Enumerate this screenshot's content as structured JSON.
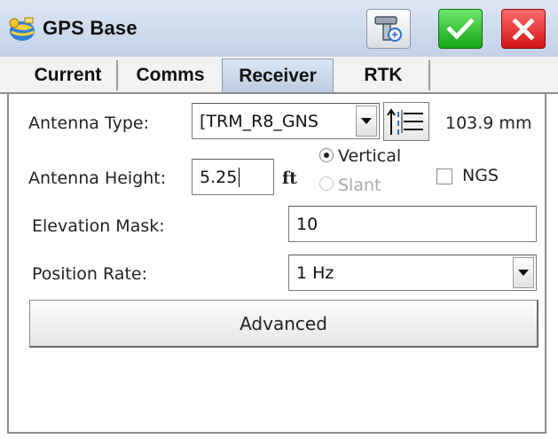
{
  "window": {
    "title": "GPS Base"
  },
  "tabs": [
    {
      "label": "Current"
    },
    {
      "label": "Comms"
    },
    {
      "label": "Receiver"
    },
    {
      "label": "RTK"
    }
  ],
  "form": {
    "antenna_type_label": "Antenna Type:",
    "antenna_type_value": "[TRM_R8_GNS",
    "antenna_offset_value": "103.9 mm",
    "antenna_height_label": "Antenna Height:",
    "antenna_height_value": "5.25",
    "antenna_height_unit": "ft",
    "vertical_label": "Vertical",
    "slant_label": "Slant",
    "ngs_label": "NGS",
    "elevation_mask_label": "Elevation Mask:",
    "elevation_mask_value": "10",
    "position_rate_label": "Position Rate:",
    "position_rate_value": "1 Hz",
    "advanced_label": "Advanced"
  },
  "colors": {
    "ok_green": "#14a714",
    "cancel_red": "#d11414",
    "tab_active": "#c7d4e7"
  },
  "icons": {
    "app": "gps-satellite-icon",
    "tool": "gps-receiver-tool-icon",
    "ok": "checkmark-icon",
    "cancel": "close-icon",
    "measure": "measure-method-icon"
  }
}
